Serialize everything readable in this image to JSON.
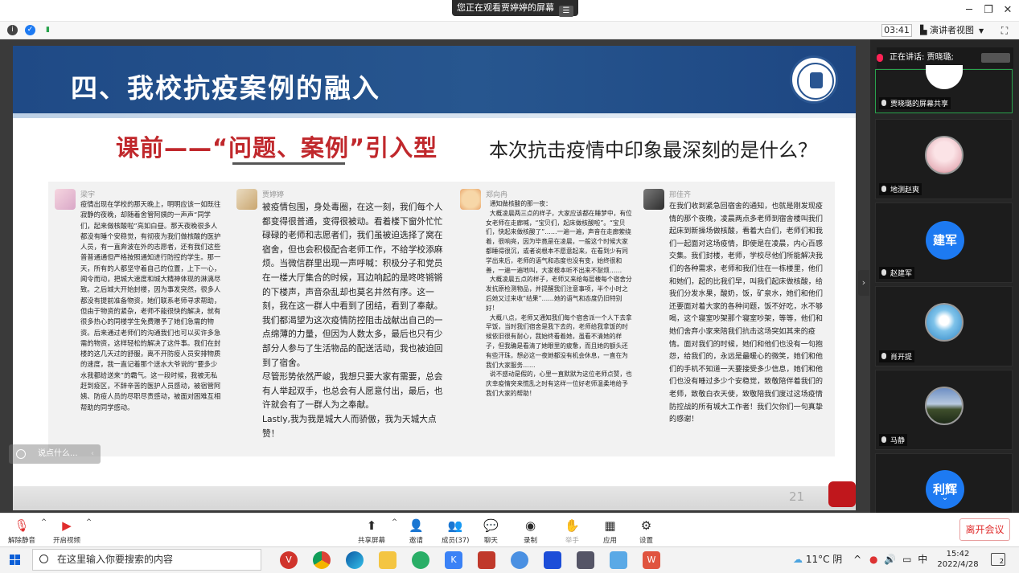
{
  "banner": {
    "share_text": "您正在观看贾婷婷的屏幕",
    "share_menu_icon": "hamburger-icon",
    "window_controls": [
      "minimize-icon",
      "restore-icon",
      "close-icon"
    ]
  },
  "toprow": {
    "timer": "03:41",
    "presenter_view": "演讲者视图",
    "status_icons": [
      "info-icon",
      "shield-icon",
      "signal-icon"
    ]
  },
  "slide": {
    "title": "四、我校抗疫案例的融入",
    "subtitle": "课前——“问题、案例”引入型",
    "question": "本次抗击疫情中印象最深刻的是什么？",
    "page_number": "21",
    "cards": [
      {
        "name": "梁宇",
        "text": "疫情出现在学校的那天晚上，明明应该一如既往寂静的夜晚，却随着舍管阿姨的一声声“同学们，起来做核酸啦”亮如白昼。那天夜晚很多人都没有睡个安稳觉，有彻夜为我们做核酸的医护人员，有一直奔波在外的志愿者，还有我们这些普普通通但严格按照通知进行防控的学生。那一天，所有的人都坚守着自己的位置，上下一心，闻令而动，把城大速度和城大精神体现的淋漓尽致。之后城大开始封楼，因为事发突然，很多人都没有提前准备物资，她们联系老师寻求帮助，但由于物资的紧杂，老师不能很快的解决，就有很多热心的同楼学生免费赠予了她们急需的物资。后来通过老师们的沟通我们也可以买许多急需的物资，这样轻松的解决了这件事。我们在封楼的这几天过的舒服，离不开防疫人员安排物质的速度，我一直记着那个送水大爷说的“要多少水我都给送来”的霸气。这一段时候，我被无私赶到疫区，不辞辛苦的医护人员感动，被宿管阿姨、防疫人员的尽职尽责感动，被面对困难互相帮助的同学感动。"
      },
      {
        "name": "贾婷婷",
        "text": "被疫情包围，身处毒圈，在这一刻，我们每个人都变得很普通，变得很被动。看着楼下窗外忙忙碌碌的老师和志愿者们，我们虽被迫选择了窝在宿舍，但也会积极配合老师工作，不给学校添麻烦。当微信群里出现一声呼喊：积极分子和党员在一楼大厅集合的时候，耳边响起的是咚咚锵锵的下楼声，声音杂乱却也莫名井然有序。这一刻，我在这一群人中看到了团结，看到了奉献。我们都渴望为这次疫情防控阻击战献出自己的一点绵薄的力量，但因为人数太多，最后也只有少部分人参与了生活物品的配送活动，我也被迫回到了宿舍。\n尽管形势依然严峻，我想只要大家有需要，总会有人举起双手，也总会有人愿意付出，最后，也许就会有了一群人为之奉献。\nLastly,我为我是城大人而骄傲，我为天城大点赞！"
      },
      {
        "name": "郑向冉",
        "text": "  通知做核酸的那一夜：\n  大概凌晨两三点的样子，大家应该都在睡梦中，有位女老师在走廊喊，“宝贝们，起床做核酸啦”。“宝贝们，快起来做核酸了”……一遍一遍，声音在走廊萦绕着，很响亮，因为毕竟是在凌晨，一般这个时候大家都睡得很沉，或者说根本不愿意起来，在看到少有同学出来后，老师的语气和态度也没有变，始终很和善，一遍一遍地叫，大家根本听不出来不耐烦……\n  大概凌晨五点的样子，老师又来给每层楼每个宿舍分发抗原检测物品，并提醒我们注意事项，半个小时之后她又过来收“结果”……她的语气和态度仍旧特别好！\n  大概八点，老师又通知我们每个宿舍派一个人下去拿早饭，当时我们宿舍是我下去的，老师给我拿饭的时候依旧很有耐心，我始终看着她，虽看不清她的样子，但我确是看清了她眼里的疲惫，而且她的额头还有些汗珠，想必这一夜她都没有机会休息，一直在为我们大家服务……\n  说不感动是假的，心里一直默默为这位老师点赞，也庆幸疫情突来慌乱之时有这样一位好老师温柔地给予我们大家的帮助！"
      },
      {
        "name": "邢佳齐",
        "text": "在我们收到紧急回宿舍的通知，也就是刚发现疫情的那个夜晚，凌晨两点多老师到宿舍楼叫我们起床到新操场做核酸，看着大白们，老师们和我们一起面对这场疫情，即使是在凌晨，内心百感交集。我们封楼，老师，学校尽他们所能解决我们的各种需求，老师和我们住在一栋楼里，他们和她们，起的比我们早，叫我们起床做核酸，给我们分发水果，酸奶，饭，矿泉水，她们和他们还要面对着大家的各种问题，饭不好吃，水不够喝，这个寝室吵架那个寝室吵架，等等，他们和她们舍弃小家来陪我们抗击这场突如其来的疫情。面对我们的时候，她们和他们也没有一句抱怨，给我们的，永远是最暖心的微笑，她们和他们的手机不知道一天要接受多少信息，她们和他们也没有睡过多少个安稳觉，致敬陪伴着我们的老师，致敬白衣天使，致敬陪我们度过这场疫情防控战的所有城大工作者！我们欠你们一句真挚的感谢！"
      }
    ]
  },
  "chat_placeholder": "说点什么...",
  "sidebar": {
    "speaking_label": "正在讲话: 贾晓璐;",
    "tiles": [
      {
        "name": "贾晓璐的屏幕共享",
        "avatar_text": ""
      },
      {
        "name": "地测赵爽",
        "avatar_text": ""
      },
      {
        "name": "赵建军",
        "avatar_text": "建军"
      },
      {
        "name": "肖开提",
        "avatar_text": ""
      },
      {
        "name": "马静",
        "avatar_text": ""
      },
      {
        "name": "",
        "avatar_text": "利辉"
      }
    ]
  },
  "toolbar": {
    "unmute": "解除静音",
    "start_video": "开启视频",
    "share_screen": "共享屏幕",
    "invite": "邀请",
    "participants": "成员(37)",
    "chat": "聊天",
    "record": "录制",
    "raise_hand": "举手",
    "apps": "应用",
    "settings": "设置",
    "leave": "离开会议"
  },
  "taskbar": {
    "search_placeholder": "在这里输入你要搜索的内容",
    "weather": "11°C 阴",
    "ime": "中",
    "time": "15:42",
    "date": "2022/4/28",
    "notification_count": "2"
  },
  "colors": {
    "slide_header": "#1f4a86",
    "accent_red": "#c0282c",
    "zoom_blue": "#1d7af2",
    "leave_red": "#e02d2d"
  }
}
